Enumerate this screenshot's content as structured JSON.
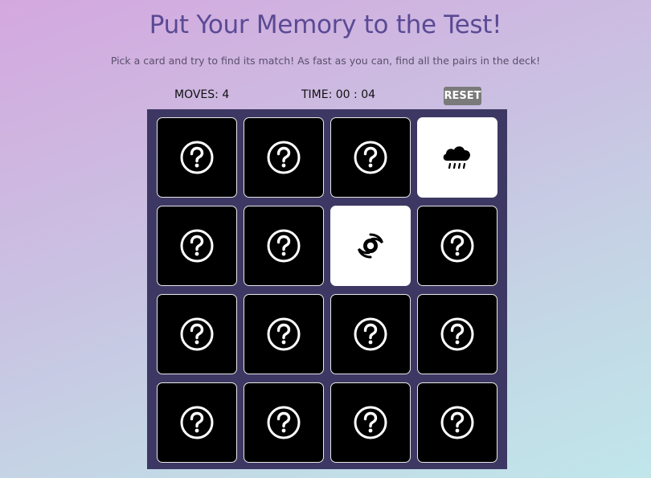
{
  "header": {
    "title": "Put Your Memory to the Test!",
    "subtitle": "Pick a card and try to find its match! As fast as you can, find all the pairs in the deck!"
  },
  "stats": {
    "moves_label": "MOVES: 4",
    "time_label": "TIME: 00 : 04",
    "reset_label": "RESET"
  },
  "colors": {
    "title": "#5a4a94",
    "deck_background": "#3d3863",
    "card_back": "#000000",
    "card_face": "#ffffff",
    "reset_button": "#7a7a7a"
  },
  "deck": {
    "cards": [
      {
        "state": "hidden",
        "icon": "question-mark-icon"
      },
      {
        "state": "hidden",
        "icon": "question-mark-icon"
      },
      {
        "state": "hidden",
        "icon": "question-mark-icon"
      },
      {
        "state": "open",
        "icon": "rain-cloud-icon"
      },
      {
        "state": "hidden",
        "icon": "question-mark-icon"
      },
      {
        "state": "hidden",
        "icon": "question-mark-icon"
      },
      {
        "state": "open",
        "icon": "hurricane-icon"
      },
      {
        "state": "hidden",
        "icon": "question-mark-icon"
      },
      {
        "state": "hidden",
        "icon": "question-mark-icon"
      },
      {
        "state": "hidden",
        "icon": "question-mark-icon"
      },
      {
        "state": "hidden",
        "icon": "question-mark-icon"
      },
      {
        "state": "hidden",
        "icon": "question-mark-icon"
      },
      {
        "state": "hidden",
        "icon": "question-mark-icon"
      },
      {
        "state": "hidden",
        "icon": "question-mark-icon"
      },
      {
        "state": "hidden",
        "icon": "question-mark-icon"
      },
      {
        "state": "hidden",
        "icon": "question-mark-icon"
      }
    ]
  }
}
